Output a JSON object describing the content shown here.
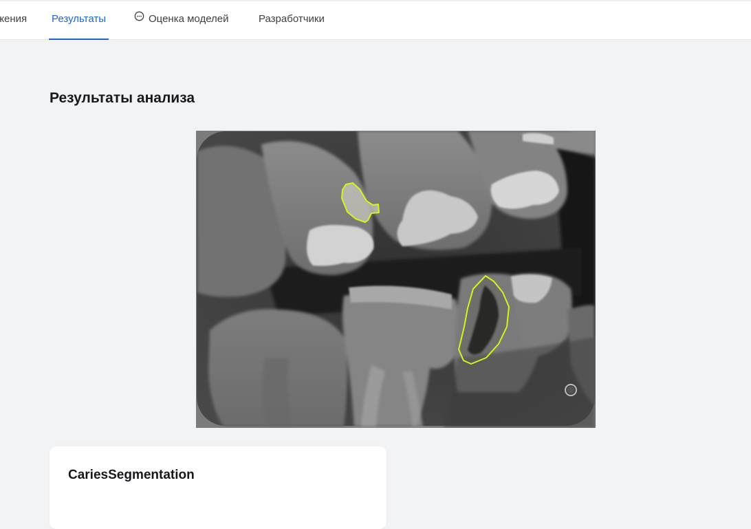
{
  "nav": {
    "tabs": [
      {
        "label": "жения"
      },
      {
        "label": "Результаты",
        "active": true
      },
      {
        "label": "Оценка моделей",
        "icon": "chat-bubble-icon"
      },
      {
        "label": "Разработчики"
      }
    ]
  },
  "main": {
    "title": "Результаты анализа",
    "image": {
      "subject": "dental bitewing x-ray",
      "highlight_color": "#d9f21a",
      "detected_regions": 2
    },
    "card": {
      "title": "CariesSegmentation"
    }
  },
  "colors": {
    "accent": "#1a66d2",
    "background": "#f2f3f5",
    "surface": "#ffffff",
    "text": "#16181b"
  }
}
